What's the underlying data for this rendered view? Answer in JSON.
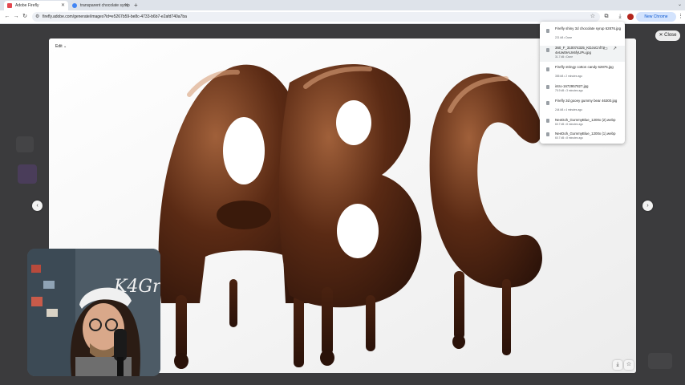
{
  "browser": {
    "tabs": [
      {
        "title": "Adobe Firefly",
        "active": true,
        "icon": "adobe-icon"
      },
      {
        "title": "transparent chocolate syrup",
        "active": false,
        "icon": "google-icon"
      }
    ],
    "url": "firefly.adobe.com/generate/images?id=e5267b59-be8c-4733-b6b7-e2afd740a7ba",
    "update_label": "New Chrome available"
  },
  "modal": {
    "edit_label": "Edit",
    "close_label": "Close"
  },
  "artwork": {
    "letters": [
      "A",
      "B",
      "C"
    ]
  },
  "downloads": {
    "items": [
      {
        "name": "Firefly shiny 3d chocolate syrup 62876.jpg",
        "meta": "221 kB • Done"
      },
      {
        "name": "360_F_310074325_KDJoCnf734eUwt9AUn6fyUPu.jpg",
        "meta": "31.7 kB • Done"
      },
      {
        "name": "Firefly stringy cotton candy 62876.jpg",
        "meta": "355 kB • 2 minutes ago"
      },
      {
        "name": "intro-1672957827.jpg",
        "meta": "75.9 kB • 3 minutes ago"
      },
      {
        "name": "Firefly 3d gooey gummy bear 46300.jpg",
        "meta": "244 kB • 4 minutes ago"
      },
      {
        "name": "NeeDoh_GummyBlue_1200x (2).webp",
        "meta": "60.7 kB • 8 minutes ago"
      },
      {
        "name": "NeeDoh_GummyBlue_1200x (1).webp",
        "meta": "60.7 kB • 8 minutes ago"
      }
    ]
  },
  "webcam": {
    "neon_text": "K4Gr"
  },
  "colors": {
    "chocolate_dark": "#2a1209",
    "chocolate_mid": "#5a2a14",
    "chocolate_light": "#a0603a",
    "background": "#ffffff"
  }
}
